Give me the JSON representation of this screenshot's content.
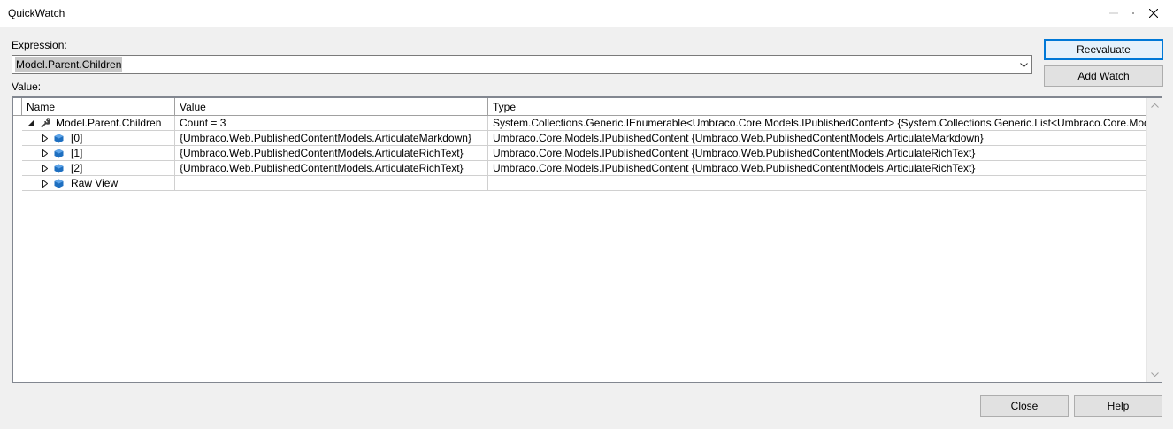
{
  "window": {
    "title": "QuickWatch"
  },
  "expression": {
    "label": "Expression:",
    "value": "Model.Parent.Children"
  },
  "value_label": "Value:",
  "buttons": {
    "reevaluate": "Reevaluate",
    "add_watch": "Add Watch",
    "close": "Close",
    "help": "Help"
  },
  "grid": {
    "columns": [
      "Name",
      "Value",
      "Type"
    ],
    "rows": [
      {
        "name": "Model.Parent.Children",
        "value": "Count = 3",
        "type": "System.Collections.Generic.IEnumerable<Umbraco.Core.Models.IPublishedContent> {System.Collections.Generic.List<Umbraco.Core.Model"
      },
      {
        "name": "[0]",
        "value": "{Umbraco.Web.PublishedContentModels.ArticulateMarkdown}",
        "type": "Umbraco.Core.Models.IPublishedContent {Umbraco.Web.PublishedContentModels.ArticulateMarkdown}"
      },
      {
        "name": "[1]",
        "value": "{Umbraco.Web.PublishedContentModels.ArticulateRichText}",
        "type": "Umbraco.Core.Models.IPublishedContent {Umbraco.Web.PublishedContentModels.ArticulateRichText}"
      },
      {
        "name": "[2]",
        "value": "{Umbraco.Web.PublishedContentModels.ArticulateRichText}",
        "type": "Umbraco.Core.Models.IPublishedContent {Umbraco.Web.PublishedContentModels.ArticulateRichText}"
      },
      {
        "name": "Raw View",
        "value": "",
        "type": ""
      }
    ]
  },
  "colors": {
    "accent": "#0078d7",
    "object_icon": "#1e6fc0"
  }
}
